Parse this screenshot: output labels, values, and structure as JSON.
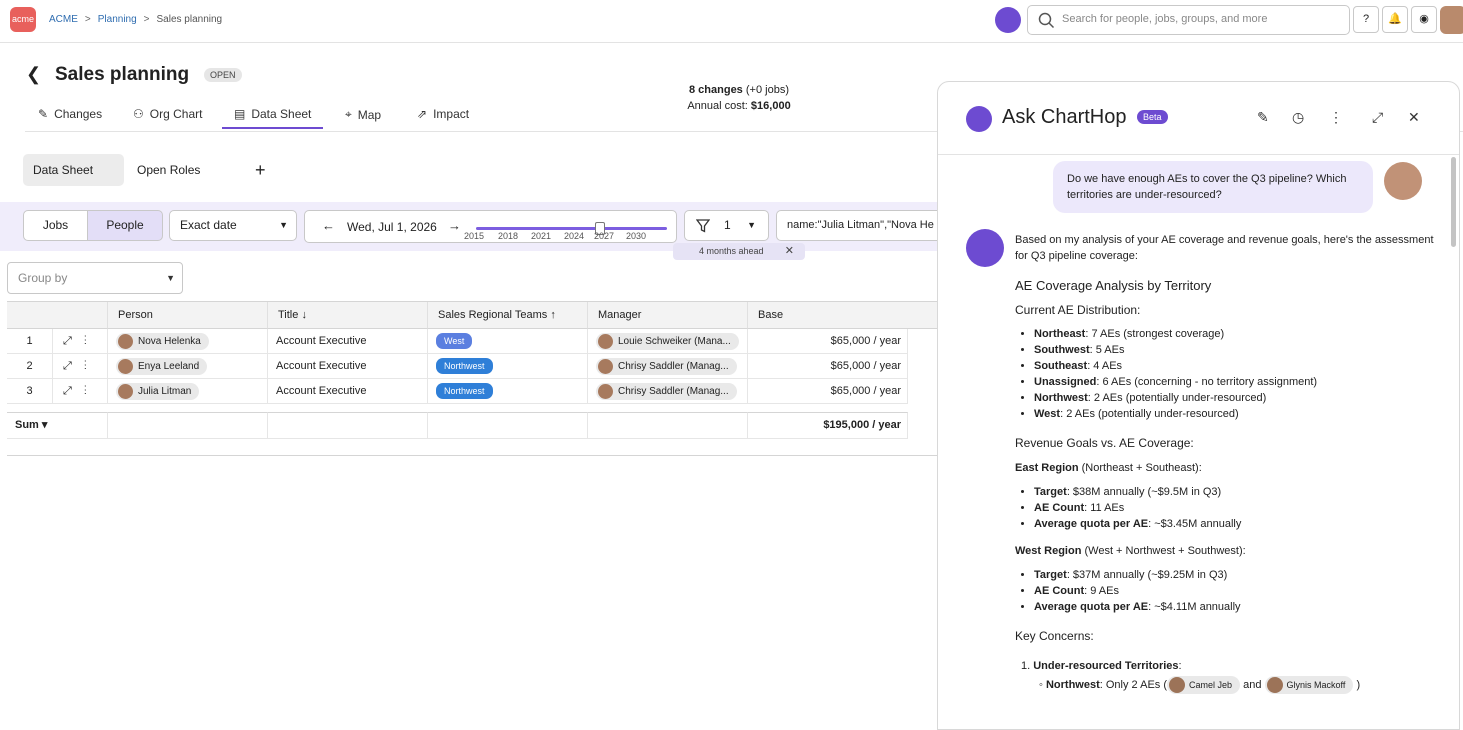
{
  "topbar": {
    "logo": "acme",
    "breadcrumb": [
      "ACME",
      "Planning",
      "Sales planning"
    ],
    "search_placeholder": "Search for people, jobs, groups, and more",
    "help": "?"
  },
  "header": {
    "title": "Sales planning",
    "status": "OPEN",
    "changes_count": "8 changes",
    "changes_jobs": "(+0 jobs)",
    "annual_cost_label": "Annual cost:",
    "annual_cost": "$16,000"
  },
  "tabs": [
    "Changes",
    "Org Chart",
    "Data Sheet",
    "Map",
    "Impact"
  ],
  "subtabs": [
    "Data Sheet",
    "Open Roles",
    "+"
  ],
  "filters": {
    "jobs": "Jobs",
    "people": "People",
    "date_mode": "Exact date",
    "date": "Wed, Jul 1, 2026",
    "years": [
      "2015",
      "2018",
      "2021",
      "2024",
      "2027",
      "2030"
    ],
    "slider_value": 0.65,
    "filter_count": "1",
    "query": "name:\"Julia Litman\",\"Nova He",
    "ahead": "4 months ahead"
  },
  "groupby": {
    "placeholder": "Group by"
  },
  "grid": {
    "columns": [
      "Person",
      "Title",
      "Sales Regional Teams",
      "Manager",
      "Base"
    ],
    "rows": [
      {
        "n": "1",
        "person": "Nova Helenka",
        "title": "Account Executive",
        "team": "West",
        "team_color": "#5b7fe0",
        "manager": "Louie Schweiker (Mana...",
        "base": "$65,000 / year"
      },
      {
        "n": "2",
        "person": "Enya Leeland",
        "title": "Account Executive",
        "team": "Northwest",
        "team_color": "#2f7fd8",
        "manager": "Chrisy Saddler (Manag...",
        "base": "$65,000 / year"
      },
      {
        "n": "3",
        "person": "Julia Litman",
        "title": "Account Executive",
        "team": "Northwest",
        "team_color": "#2f7fd8",
        "manager": "Chrisy Saddler (Manag...",
        "base": "$65,000 / year"
      }
    ],
    "sum_label": "Sum ▾",
    "sum_value": "$195,000 / year"
  },
  "panel": {
    "title": "Ask ChartHop",
    "beta": "Beta",
    "question": "Do we have enough AEs to cover the Q3 pipeline? Which territories are under-resourced?",
    "intro": "Based on my analysis of your AE coverage and revenue goals, here's the assessment for Q3 pipeline coverage:",
    "h1": "AE Coverage Analysis by Territory",
    "dist_title": "Current AE Distribution:",
    "dist": [
      {
        "k": "Northeast",
        "v": ": 7 AEs (strongest coverage)"
      },
      {
        "k": "Southwest",
        "v": ": 5 AEs"
      },
      {
        "k": "Southeast",
        "v": ": 4 AEs"
      },
      {
        "k": "Unassigned",
        "v": ": 6 AEs (concerning - no territory assignment)"
      },
      {
        "k": "Northwest",
        "v": ": 2 AEs (potentially under-resourced)"
      },
      {
        "k": "West",
        "v": ": 2 AEs (potentially under-resourced)"
      }
    ],
    "rev_title": "Revenue Goals vs. AE Coverage:",
    "east_k": "East Region",
    "east_v": " (Northeast + Southeast):",
    "east": [
      {
        "k": "Target",
        "v": ": $38M annually (~$9.5M in Q3)"
      },
      {
        "k": "AE Count",
        "v": ": 11 AEs"
      },
      {
        "k": "Average quota per AE",
        "v": ": ~$3.45M annually"
      }
    ],
    "west_k": "West Region",
    "west_v": " (West + Northwest + Southwest):",
    "west": [
      {
        "k": "Target",
        "v": ": $37M annually (~$9.25M in Q3)"
      },
      {
        "k": "AE Count",
        "v": ": 9 AEs"
      },
      {
        "k": "Average quota per AE",
        "v": ": ~$4.11M annually"
      }
    ],
    "concerns_title": "Key Concerns:",
    "concern1": "Under-resourced Territories",
    "nw_k": "Northwest",
    "nw_v": ": Only 2 AEs (",
    "person_a": "Camel Jeb",
    "and": "and",
    "person_b": "Glynis Mackoff",
    "close": ")"
  }
}
